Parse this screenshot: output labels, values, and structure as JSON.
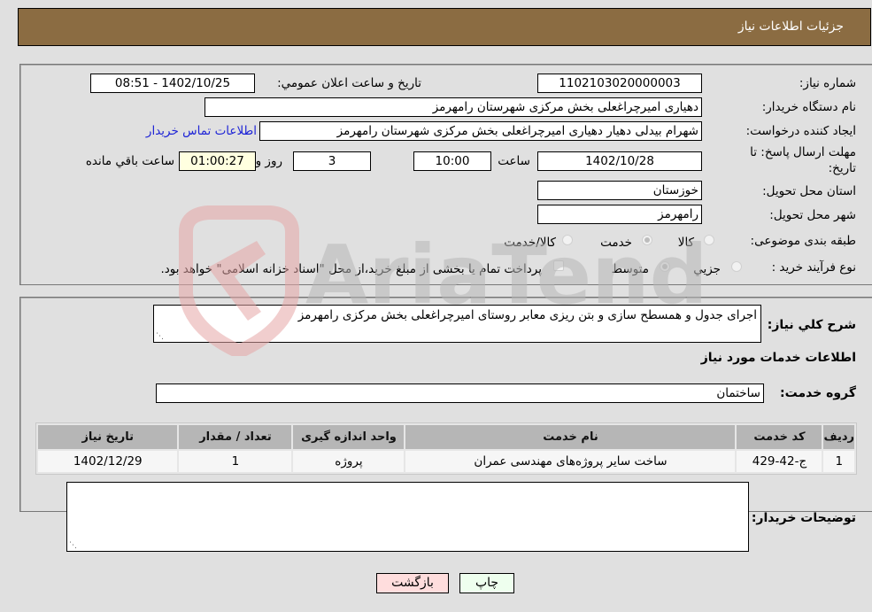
{
  "header": {
    "title": "جزئیات اطلاعات نیاز"
  },
  "form": {
    "need_number_label": "شماره نیاز:",
    "need_number": "1102103020000003",
    "announce_label": "تاریخ و ساعت اعلان عمومي:",
    "announce_value": "1402/10/25 - 08:51",
    "buyer_org_label": "نام دستگاه خریدار:",
    "buyer_org": "دهیاری امیرچراغعلی بخش مرکزی شهرستان رامهرمز",
    "creator_label": "ایجاد کننده درخواست:",
    "creator": "شهرام بیدلی دهیار دهیاری امیرچراغعلی بخش مرکزی شهرستان رامهرمز",
    "contact_link": "اطلاعات تماس خریدار",
    "deadline_label_line1": "مهلت ارسال پاسخ: تا",
    "deadline_label_line2": "تاریخ:",
    "deadline_date": "1402/10/28",
    "time_label": "ساعت",
    "deadline_time": "10:00",
    "days_value": "3",
    "days_label": "روز و",
    "remaining_value": "01:00:27",
    "remaining_label": "ساعت باقي مانده",
    "province_label": "استان محل تحویل:",
    "province": "خوزستان",
    "city_label": "شهر محل تحویل:",
    "city": "رامهرمز",
    "category_label": "طبقه بندی موضوعی:",
    "category_options": [
      {
        "label": "کالا",
        "checked": false
      },
      {
        "label": "خدمت",
        "checked": true
      },
      {
        "label": "کالا/خدمت",
        "checked": false
      }
    ],
    "purchase_type_label": "نوع فرآیند خرید :",
    "purchase_type_options": [
      {
        "label": "جزيي",
        "checked": false
      },
      {
        "label": "متوسط",
        "checked": true
      }
    ],
    "treasury_note": "پرداخت تمام یا بخشی از مبلغ خرید،از محل \"اسناد خزانه اسلامی\" خواهد بود."
  },
  "details": {
    "description_label": "شرح کلي نیاز:",
    "description": "اجرای جدول و همسطح سازی و بتن ریزی معابر روستای امیرچراغعلی بخش مرکزی رامهرمز",
    "services_heading": "اطلاعات خدمات مورد نیاز",
    "service_group_label": "گروه خدمت:",
    "service_group": "ساختمان",
    "table": {
      "headers": [
        "ردیف",
        "کد خدمت",
        "نام خدمت",
        "واحد اندازه گیری",
        "تعداد / مقدار",
        "تاریخ نیاز"
      ],
      "rows": [
        [
          "1",
          "ج-42-429",
          "ساخت سایر پروژه‌های مهندسی عمران",
          "پروژه",
          "1",
          "1402/12/29"
        ]
      ]
    },
    "buyer_notes_label": "توضیحات خریدار:",
    "buyer_notes": ""
  },
  "buttons": {
    "print": "چاپ",
    "back": "بازگشت"
  },
  "watermark": {
    "text": "AriaTender.neT"
  }
}
